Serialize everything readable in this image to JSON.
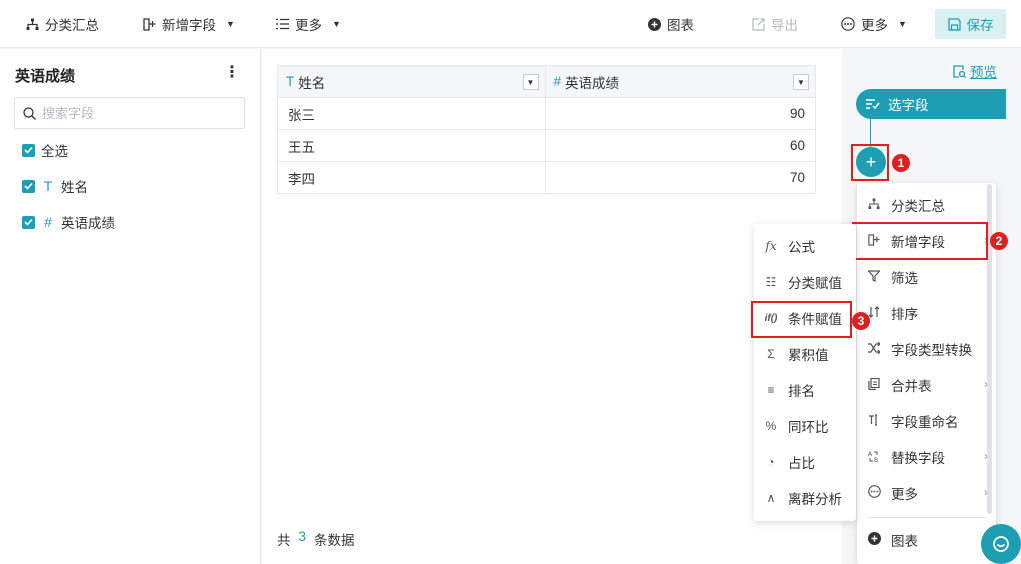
{
  "toolbar": {
    "classify_summary": "分类汇总",
    "add_field": "新增字段",
    "more_left": "更多",
    "chart": "图表",
    "export": "导出",
    "more_right": "更多",
    "save": "保存"
  },
  "left_panel": {
    "title": "英语成绩",
    "search_placeholder": "搜索字段",
    "select_all": "全选",
    "fields": [
      {
        "type_icon": "T",
        "name": "姓名"
      },
      {
        "type_icon": "#",
        "name": "英语成绩"
      }
    ]
  },
  "table": {
    "columns": [
      {
        "type_icon": "T",
        "name": "姓名"
      },
      {
        "type_icon": "#",
        "name": "英语成绩"
      }
    ],
    "rows": [
      {
        "name": "张三",
        "score": "90"
      },
      {
        "name": "王五",
        "score": "60"
      },
      {
        "name": "李四",
        "score": "70"
      }
    ],
    "footer_prefix": "共",
    "footer_count": "3",
    "footer_suffix": "条数据"
  },
  "right_panel": {
    "preview": "预览",
    "step_label": "选字段",
    "add_symbol": "+"
  },
  "menu": {
    "items": [
      {
        "label": "分类汇总",
        "icon": "sitemap-icon"
      },
      {
        "label": "新增字段",
        "icon": "add-field-icon"
      },
      {
        "label": "筛选",
        "icon": "filter-icon"
      },
      {
        "label": "排序",
        "icon": "sort-icon"
      },
      {
        "label": "字段类型转换",
        "icon": "shuffle-icon"
      },
      {
        "label": "合并表",
        "icon": "merge-table-icon"
      },
      {
        "label": "字段重命名",
        "icon": "rename-icon"
      },
      {
        "label": "替换字段",
        "icon": "replace-icon"
      },
      {
        "label": "更多",
        "icon": "more-icon"
      },
      {
        "label": "图表",
        "icon": "chart-plus-icon"
      }
    ]
  },
  "submenu": {
    "items": [
      {
        "label": "公式",
        "glyph": "fx"
      },
      {
        "label": "分类赋值",
        "glyph": "☷"
      },
      {
        "label": "条件赋值",
        "glyph": "if()"
      },
      {
        "label": "累积值",
        "glyph": "Σ"
      },
      {
        "label": "排名",
        "glyph": "≡"
      },
      {
        "label": "同环比",
        "glyph": "%"
      },
      {
        "label": "占比",
        "glyph": "◔"
      },
      {
        "label": "离群分析",
        "glyph": "∧"
      }
    ]
  },
  "markers": [
    "1",
    "2",
    "3"
  ],
  "colors": {
    "accent": "#1e9eb3",
    "highlight": "#e02020"
  }
}
